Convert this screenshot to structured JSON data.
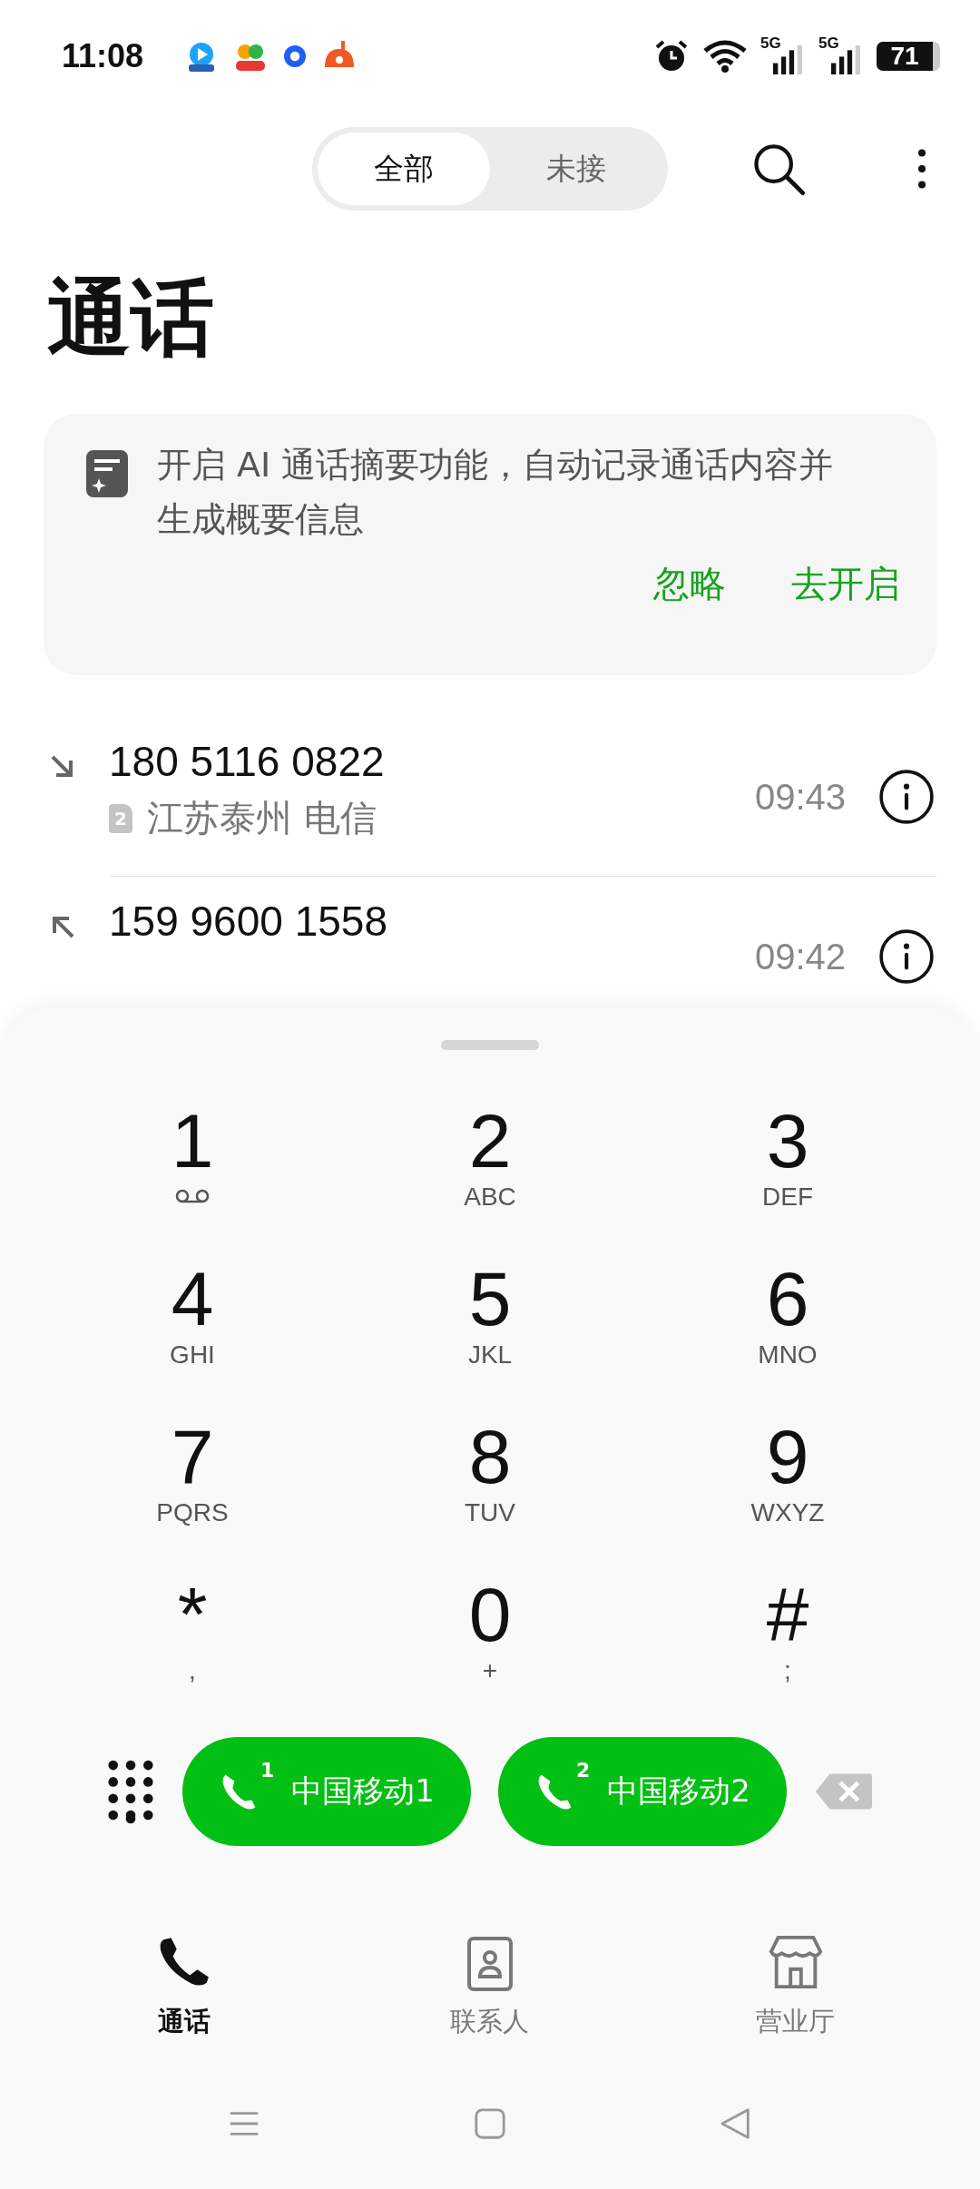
{
  "status_bar": {
    "time": "11:08",
    "battery": "71",
    "sims": [
      {
        "network": "5G"
      },
      {
        "network": "5G"
      }
    ]
  },
  "filter_tabs": [
    {
      "label": "全部",
      "selected": true
    },
    {
      "label": "未接",
      "selected": false
    }
  ],
  "title": "通话",
  "ai_banner": {
    "text": "开启 AI 通话摘要功能，自动记录通话内容并生成概要信息",
    "actions": [
      "忽略",
      "去开启"
    ]
  },
  "calls": [
    {
      "number": "180 5116 0822",
      "kind": "incoming",
      "sim": "2",
      "location": "江苏泰州 电信",
      "time": "09:43"
    },
    {
      "number": "159 9600 1558",
      "kind": "outgoing",
      "time": "09:42"
    }
  ],
  "keypad": [
    {
      "digit": "1",
      "kind": "voicemail"
    },
    {
      "digit": "2",
      "letters": "ABC",
      "kind": "letters"
    },
    {
      "digit": "3",
      "letters": "DEF",
      "kind": "letters"
    },
    {
      "digit": "4",
      "letters": "GHI",
      "kind": "letters"
    },
    {
      "digit": "5",
      "letters": "JKL",
      "kind": "letters"
    },
    {
      "digit": "6",
      "letters": "MNO",
      "kind": "letters"
    },
    {
      "digit": "7",
      "letters": "PQRS",
      "kind": "letters"
    },
    {
      "digit": "8",
      "letters": "TUV",
      "kind": "letters"
    },
    {
      "digit": "9",
      "letters": "WXYZ",
      "kind": "letters"
    },
    {
      "digit": "*",
      "letters": ",",
      "kind": "letters"
    },
    {
      "digit": "0",
      "letters": "+",
      "kind": "letters"
    },
    {
      "digit": "#",
      "letters": ";",
      "kind": "letters"
    }
  ],
  "dial_buttons": [
    {
      "sim": "1",
      "label": "中国移动1"
    },
    {
      "sim": "2",
      "label": "中国移动2"
    }
  ],
  "bottom_nav": [
    {
      "label": "通话",
      "kind": "phone",
      "selected": true
    },
    {
      "label": "联系人",
      "kind": "contacts",
      "selected": false
    },
    {
      "label": "营业厅",
      "kind": "store",
      "selected": false
    }
  ]
}
